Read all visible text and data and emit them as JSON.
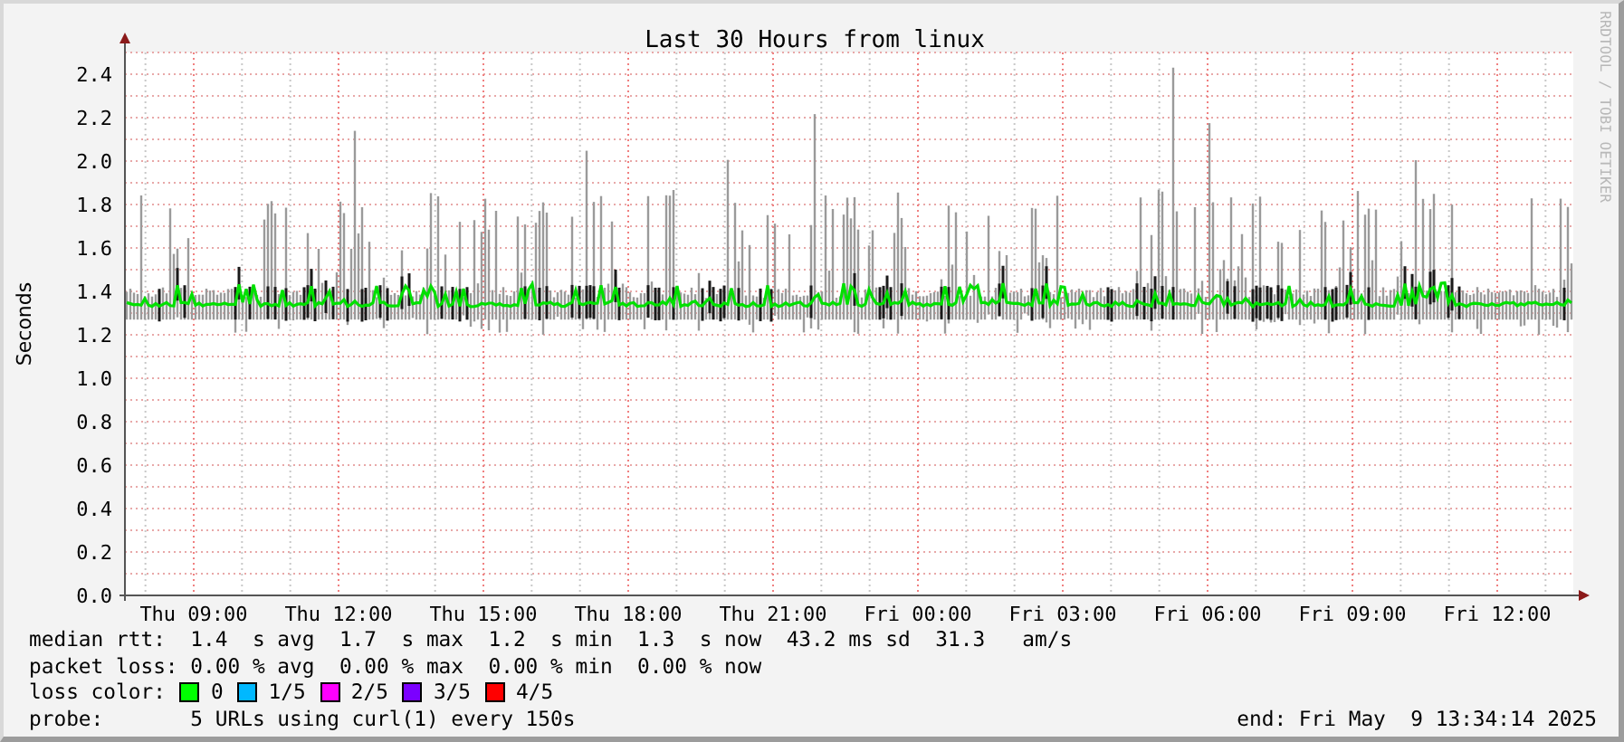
{
  "title": "Last 30 Hours from linux",
  "y_axis_label": "Seconds",
  "y_ticks": [
    "2.4",
    "2.2",
    "2.0",
    "1.8",
    "1.6",
    "1.4",
    "1.2",
    "1.0",
    "0.8",
    "0.6",
    "0.4",
    "0.2",
    "0.0"
  ],
  "x_ticks": [
    "Thu 09:00",
    "Thu 12:00",
    "Thu 15:00",
    "Thu 18:00",
    "Thu 21:00",
    "Fri 00:00",
    "Fri 03:00",
    "Fri 06:00",
    "Fri 09:00",
    "Fri 12:00"
  ],
  "credit": "RRDTOOL / TOBI OETIKER",
  "legend": {
    "median_rtt": "median rtt:  1.4  s avg  1.7  s max  1.2  s min  1.3  s now  43.2 ms sd  31.3   am/s",
    "packet_loss": "packet loss: 0.00 % avg  0.00 % max  0.00 % min  0.00 % now",
    "loss_color": {
      "label": "loss color:",
      "items": [
        {
          "label": "0",
          "color": "#00ff00"
        },
        {
          "label": "1/5",
          "color": "#00b8ff"
        },
        {
          "label": "2/5",
          "color": "#ff00ff"
        },
        {
          "label": "3/5",
          "color": "#7b00ff"
        },
        {
          "label": "4/5",
          "color": "#ff0000"
        }
      ]
    },
    "probe": "probe:       5 URLs using curl(1) every 150s",
    "end": "end: Fri May  9 13:34:14 2025"
  }
}
